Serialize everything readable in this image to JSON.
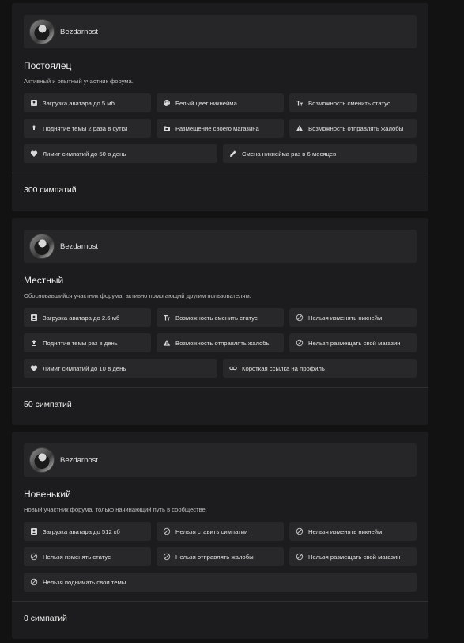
{
  "ranks": [
    {
      "username": "Bezdarnost",
      "title": "Постоялец",
      "description": "Активный и опытный участник форума.",
      "perks_grid": [
        {
          "icon": "avatar-upload-icon",
          "label": "Загрузка аватара до 5 мб"
        },
        {
          "icon": "palette-icon",
          "label": "Белый цвет никнейма"
        },
        {
          "icon": "text-size-icon",
          "label": "Возможность сменить статус"
        },
        {
          "icon": "upload-icon",
          "label": "Поднятие темы 2 раза в сутки"
        },
        {
          "icon": "store-folder-icon",
          "label": "Размещение своего магазина"
        },
        {
          "icon": "warning-icon",
          "label": "Возможность отправлять жалобы"
        }
      ],
      "perks_row": [
        {
          "icon": "heart-icon",
          "label": "Лимит симпатий до 50 в день"
        },
        {
          "icon": "pencil-icon",
          "label": "Смена никнейма раз в 6 месяцев"
        }
      ],
      "likes": "300 симпатий"
    },
    {
      "username": "Bezdarnost",
      "title": "Местный",
      "description": "Обосновавшийся участник форума, активно помогающий другим пользователям.",
      "perks_grid": [
        {
          "icon": "avatar-upload-icon",
          "label": "Загрузка аватара до 2.6 мб"
        },
        {
          "icon": "text-size-icon",
          "label": "Возможность сменить статус"
        },
        {
          "icon": "blocked-icon",
          "label": "Нельзя изменять никнейм"
        },
        {
          "icon": "upload-icon",
          "label": "Поднятие темы раз в день"
        },
        {
          "icon": "warning-icon",
          "label": "Возможность отправлять жалобы"
        },
        {
          "icon": "blocked-icon",
          "label": "Нельзя размещать свой магазин"
        }
      ],
      "perks_row": [
        {
          "icon": "heart-icon",
          "label": "Лимит симпатий до 10 в день"
        },
        {
          "icon": "link-icon",
          "label": "Короткая ссылка на профиль"
        }
      ],
      "likes": "50 симпатий"
    },
    {
      "username": "Bezdarnost",
      "title": "Новенький",
      "description": "Новый участник форума, только начинающий путь в сообществе.",
      "perks_grid": [
        {
          "icon": "avatar-upload-icon",
          "label": "Загрузка аватара до 512 кб"
        },
        {
          "icon": "blocked-icon",
          "label": "Нельзя ставить симпатии"
        },
        {
          "icon": "blocked-icon",
          "label": "Нельзя изменять никнейм"
        },
        {
          "icon": "blocked-icon",
          "label": "Нельзя изменять статус"
        },
        {
          "icon": "blocked-icon",
          "label": "Нельзя отправлять жалобы"
        },
        {
          "icon": "blocked-icon",
          "label": "Нельзя размещать свой магазин"
        }
      ],
      "perks_full": [
        {
          "icon": "blocked-icon",
          "label": "Нельзя поднимать свои темы"
        }
      ],
      "likes": "0 симпатий"
    }
  ]
}
